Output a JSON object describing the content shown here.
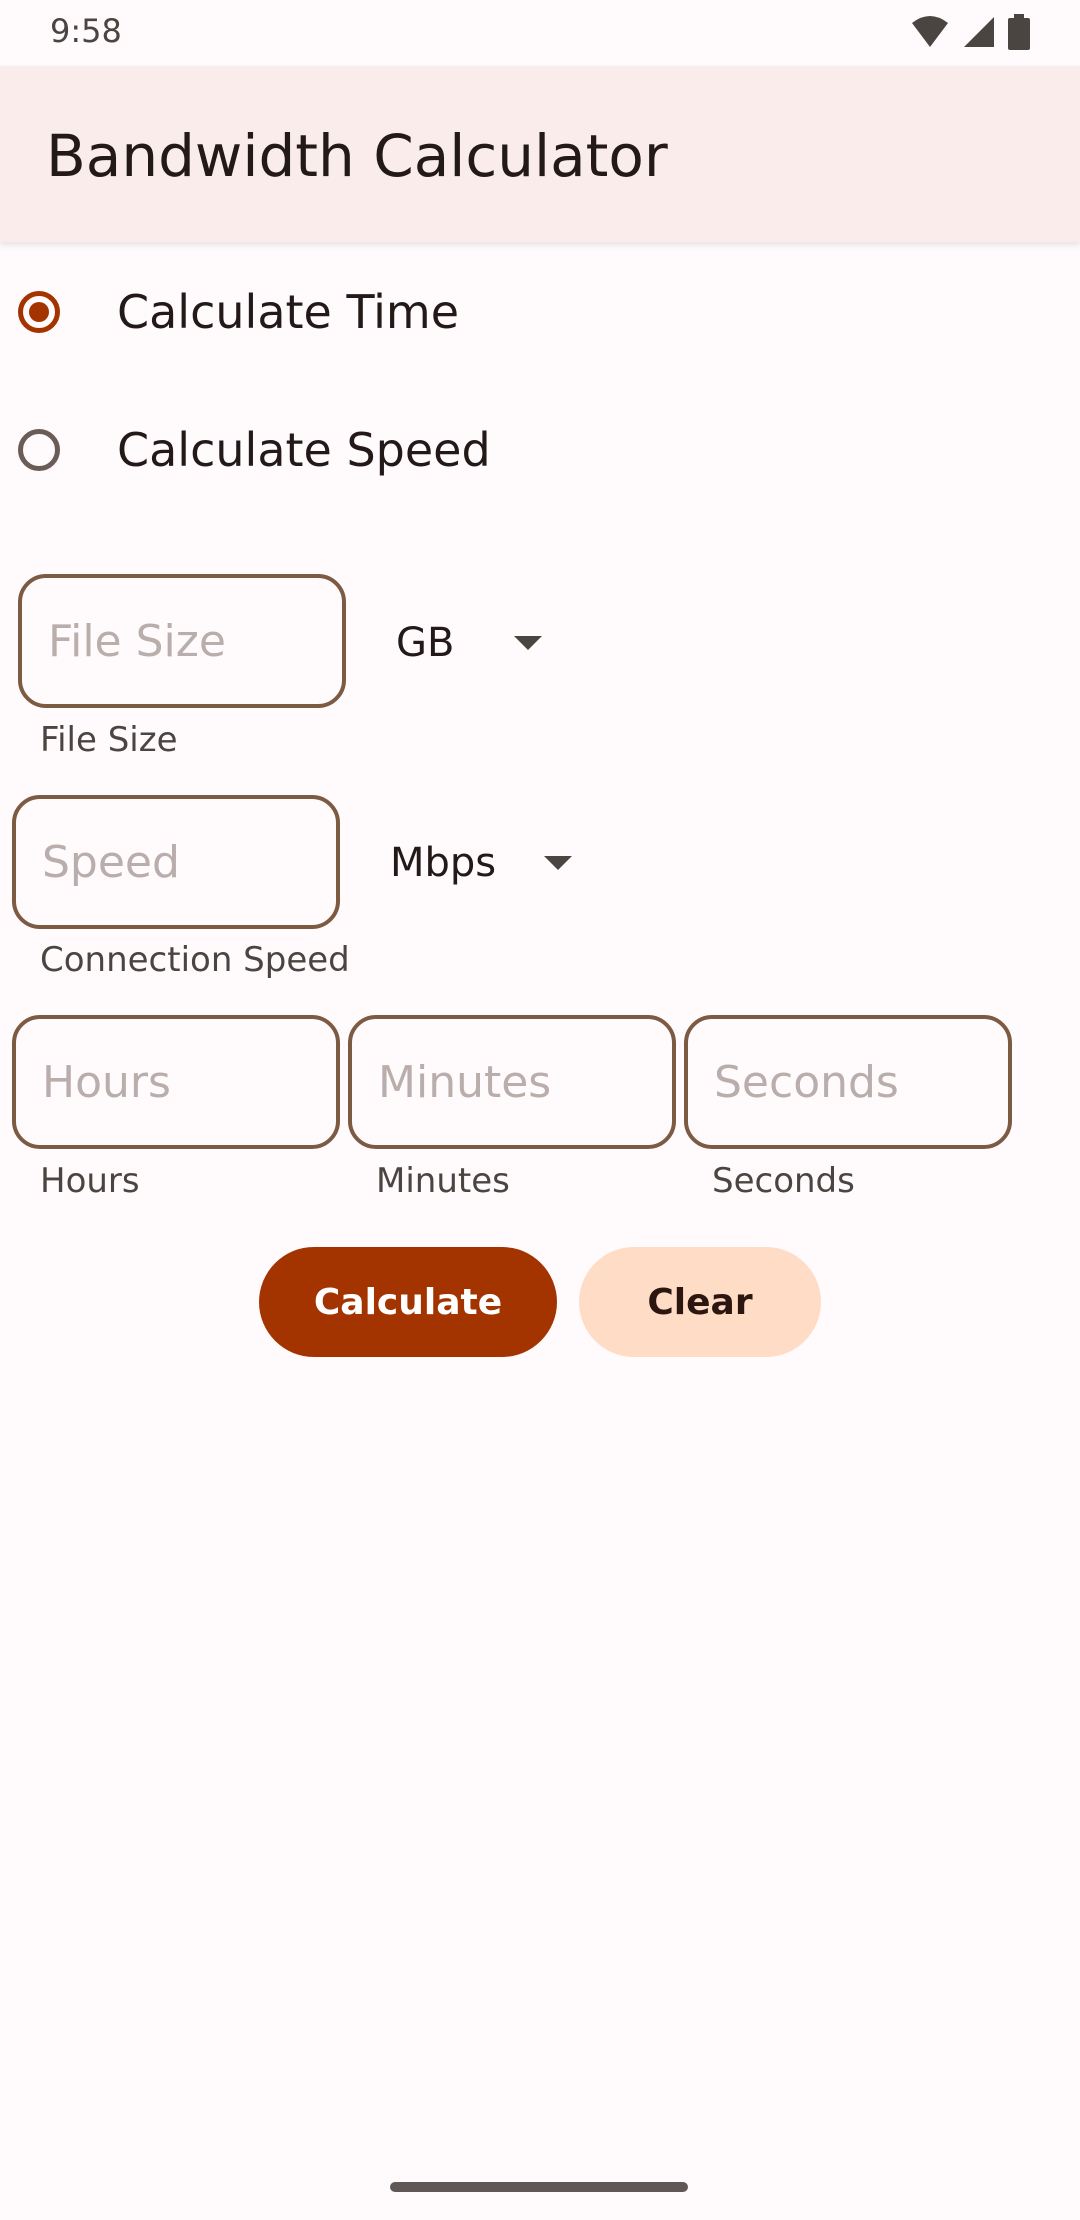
{
  "status_bar": {
    "time": "9:58",
    "icons": [
      "wifi-icon",
      "cellular-signal-icon",
      "battery-icon"
    ]
  },
  "app_bar": {
    "title": "Bandwidth Calculator"
  },
  "mode": {
    "options": [
      {
        "label": "Calculate Time",
        "checked": true
      },
      {
        "label": "Calculate Speed",
        "checked": false
      }
    ]
  },
  "file_size": {
    "value": "",
    "placeholder": "File Size",
    "label": "File Size",
    "unit": "GB"
  },
  "speed": {
    "value": "",
    "placeholder": "Speed",
    "label": "Connection Speed",
    "unit": "Mbps"
  },
  "time": {
    "hours": {
      "value": "",
      "placeholder": "Hours",
      "label": "Hours"
    },
    "minutes": {
      "value": "",
      "placeholder": "Minutes",
      "label": "Minutes"
    },
    "seconds": {
      "value": "",
      "placeholder": "Seconds",
      "label": "Seconds"
    }
  },
  "actions": {
    "calculate_label": "Calculate",
    "clear_label": "Clear"
  },
  "colors": {
    "primary": "#a33400",
    "secondary_container": "#ffdcc6",
    "app_bar": "#f9eceb",
    "outline": "#7d5a42",
    "background": "#fffbfd"
  }
}
